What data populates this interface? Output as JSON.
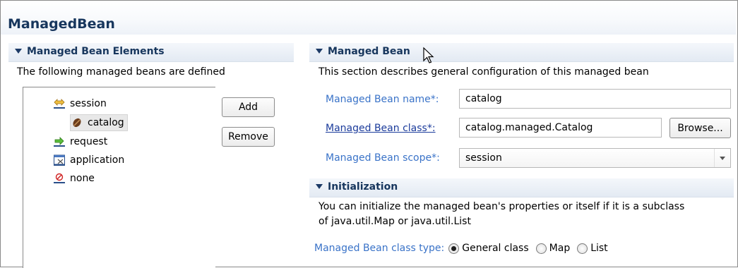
{
  "page": {
    "title": "ManagedBean"
  },
  "elements_section": {
    "title": "Managed Bean Elements",
    "description": "The following managed beans are defined",
    "tree": [
      {
        "label": "session",
        "icon": "session-scope-icon"
      },
      {
        "label": "catalog",
        "icon": "bean-icon",
        "selected": true
      },
      {
        "label": "request",
        "icon": "request-scope-icon"
      },
      {
        "label": "application",
        "icon": "application-scope-icon"
      },
      {
        "label": "none",
        "icon": "none-scope-icon"
      }
    ],
    "add_label": "Add",
    "remove_label": "Remove"
  },
  "bean_section": {
    "title": "Managed Bean",
    "description": "This section describes general configuration of this managed bean",
    "name_label": "Managed Bean name*:",
    "name_value": "catalog",
    "class_label": "Managed Bean class*:",
    "class_value": "catalog.managed.Catalog",
    "browse_label": "Browse...",
    "scope_label": "Managed Bean scope*:",
    "scope_value": "session"
  },
  "init_section": {
    "title": "Initialization",
    "description_line1": "You can initialize the managed bean's properties or itself if it is a subclass",
    "description_line2": "of java.util.Map or java.util.List",
    "class_type_label": "Managed Bean class type:",
    "options": [
      {
        "label": "General class",
        "selected": true
      },
      {
        "label": "Map",
        "selected": false
      },
      {
        "label": "List",
        "selected": false
      }
    ]
  },
  "colors": {
    "title": "#17365d",
    "label_blue": "#3a73c8",
    "link": "#1b3b9b"
  }
}
